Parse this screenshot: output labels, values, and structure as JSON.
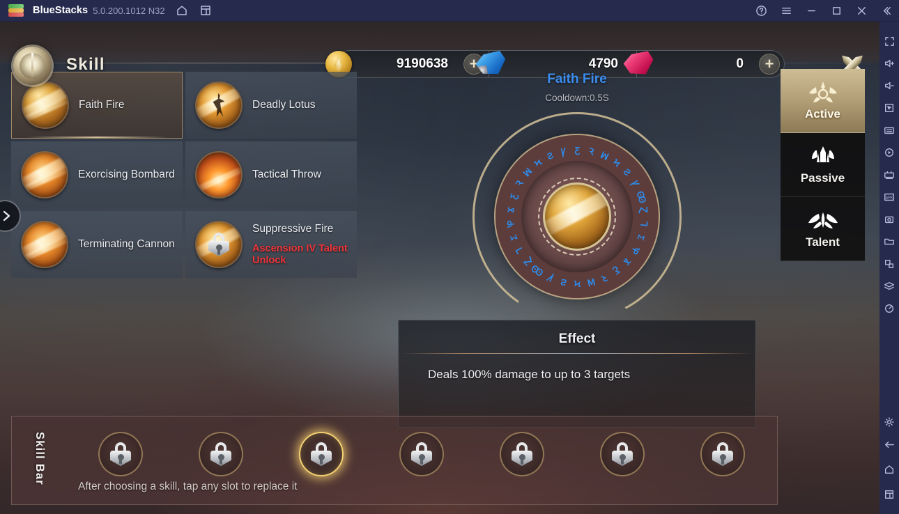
{
  "titlebar": {
    "app_name": "BlueStacks",
    "version": "5.0.200.1012 N32",
    "icons": [
      "home-icon",
      "multi-instance-icon"
    ],
    "right_buttons": [
      "help-icon",
      "menu-icon",
      "minimize-icon",
      "maximize-icon",
      "close-icon",
      "collapse-icon"
    ]
  },
  "game_header": {
    "page_title": "Skill",
    "currencies": [
      {
        "name": "gold",
        "value": "9190638",
        "has_plus": true
      },
      {
        "name": "diamond",
        "value": "4790",
        "has_plus": false
      },
      {
        "name": "ruby",
        "value": "0",
        "has_plus": true
      }
    ],
    "close_label": "close"
  },
  "skills": [
    {
      "name": "Faith Fire",
      "selected": true,
      "locked": false,
      "note": ""
    },
    {
      "name": "Deadly Lotus",
      "selected": false,
      "locked": false,
      "note": ""
    },
    {
      "name": "Exorcising Bombard",
      "selected": false,
      "locked": false,
      "note": ""
    },
    {
      "name": "Tactical Throw",
      "selected": false,
      "locked": false,
      "note": ""
    },
    {
      "name": "Terminating Cannon",
      "selected": false,
      "locked": false,
      "note": ""
    },
    {
      "name": "Suppressive Fire",
      "selected": false,
      "locked": true,
      "note": "Ascension IV Talent Unlock"
    }
  ],
  "detail": {
    "skill_name": "Faith Fire",
    "cooldown": "Cooldown:0.5S",
    "effect_title": "Effect",
    "effect_text": "Deals 100% damage to up to 3 targets",
    "accent_color": "#3b8ef0"
  },
  "tabs": [
    {
      "label": "Active",
      "icon": "crown-wings-icon",
      "active": true
    },
    {
      "label": "Passive",
      "icon": "helm-wings-icon",
      "active": false
    },
    {
      "label": "Talent",
      "icon": "feather-wings-icon",
      "active": false
    }
  ],
  "skill_bar": {
    "label": "Skill Bar",
    "hint": "After choosing a skill, tap any slot to replace it",
    "slot_count": 7,
    "highlighted_slot": 3,
    "slot_icon": "lock-icon"
  },
  "sidebar_tools": [
    "fullscreen-icon",
    "volume-up-icon",
    "volume-down-icon",
    "cursor-icon",
    "keyboard-icon",
    "macro-icon",
    "multi-instance-manager-icon",
    "install-apk-icon",
    "screenshot-icon",
    "folder-icon",
    "rotate-icon",
    "layers-icon",
    "performance-icon"
  ],
  "sidebar_tools_bottom": [
    "settings-icon",
    "back-icon",
    "home-icon",
    "recents-icon"
  ]
}
